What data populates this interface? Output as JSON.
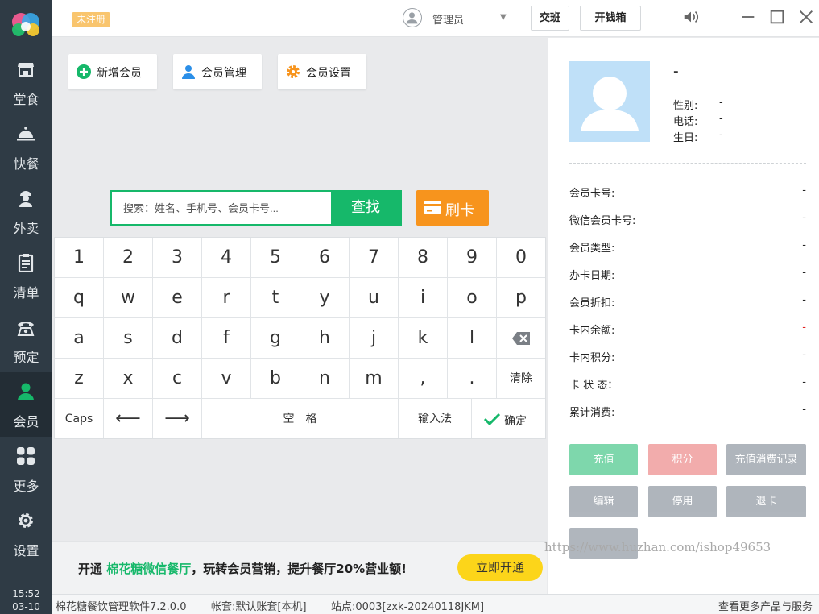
{
  "app": {
    "unregistered_badge": "未注册",
    "user_name": "管理员",
    "handover_label": "交班",
    "cashbox_label": "开钱箱"
  },
  "sidebar": {
    "items": [
      {
        "label": "堂食",
        "icon": "store-icon"
      },
      {
        "label": "快餐",
        "icon": "cloche-icon"
      },
      {
        "label": "外卖",
        "icon": "courier-icon"
      },
      {
        "label": "清单",
        "icon": "clipboard-icon"
      },
      {
        "label": "预定",
        "icon": "phone-icon"
      },
      {
        "label": "会员",
        "icon": "member-icon",
        "active": true
      },
      {
        "label": "更多",
        "icon": "grid-icon"
      },
      {
        "label": "设置",
        "icon": "gear-icon"
      }
    ],
    "clock_time": "15:52",
    "clock_date": "03-10"
  },
  "toolbar": {
    "add_member_label": "新增会员",
    "member_manage_label": "会员管理",
    "member_settings_label": "会员设置"
  },
  "search": {
    "placeholder": "搜索：姓名、手机号、会员卡号...",
    "find_label": "查找",
    "swipe_card_label": "刷卡"
  },
  "keyboard": {
    "row1": [
      "1",
      "2",
      "3",
      "4",
      "5",
      "6",
      "7",
      "8",
      "9",
      "0"
    ],
    "row2": [
      "q",
      "w",
      "e",
      "r",
      "t",
      "y",
      "u",
      "i",
      "o",
      "p"
    ],
    "row3": [
      "a",
      "s",
      "d",
      "f",
      "g",
      "h",
      "j",
      "k",
      "l"
    ],
    "row4": [
      "z",
      "x",
      "c",
      "v",
      "b",
      "n",
      "m",
      ",",
      "."
    ],
    "clear_label": "清除",
    "caps_label": "Caps",
    "left_arrow": "⟵",
    "right_arrow": "⟶",
    "space_label": "空　格",
    "ime_label": "输入法",
    "confirm_label": "确定"
  },
  "member_panel": {
    "name": "-",
    "gender_label": "性别:",
    "gender_value": "-",
    "phone_label": "电话:",
    "phone_value": "-",
    "birthday_label": "生日:",
    "birthday_value": "-",
    "details": [
      {
        "label": "会员卡号:",
        "value": "-"
      },
      {
        "label": "微信会员卡号:",
        "value": "-"
      },
      {
        "label": "会员类型:",
        "value": "-"
      },
      {
        "label": "办卡日期:",
        "value": "-"
      },
      {
        "label": "会员折扣:",
        "value": "-"
      },
      {
        "label": "卡内余额:",
        "value": "-"
      },
      {
        "label": "卡内积分:",
        "value": "-"
      },
      {
        "label": "卡 状 态：",
        "value": "-"
      },
      {
        "label": "累计消费:",
        "value": "-"
      }
    ],
    "actions": {
      "recharge": "充值",
      "points": "积分",
      "recharge_history": "充值消费记录",
      "edit": "编辑",
      "disable": "停用",
      "refund": "退卡"
    }
  },
  "promo": {
    "prefix": "开通 ",
    "highlight": "棉花糖微信餐厅",
    "suffix": "，玩转会员营销，提升餐厅20%营业额!",
    "button_label": "立即开通"
  },
  "watermark": "https://www.huzhan.com/ishop49653",
  "status_bar": {
    "version": "棉花糖餐饮管理软件7.2.0.0",
    "account": "帐套:默认账套[本机]",
    "station": "站点:0003[zxk-20240118JKM]",
    "more_link": "查看更多产品与服务"
  },
  "colors": {
    "sidebar_bg": "#2f3b45",
    "accent_green": "#16b86a",
    "card_orange": "#f7941d",
    "promo_yellow": "#fcd51a",
    "balance_value_red": "#e02020"
  }
}
